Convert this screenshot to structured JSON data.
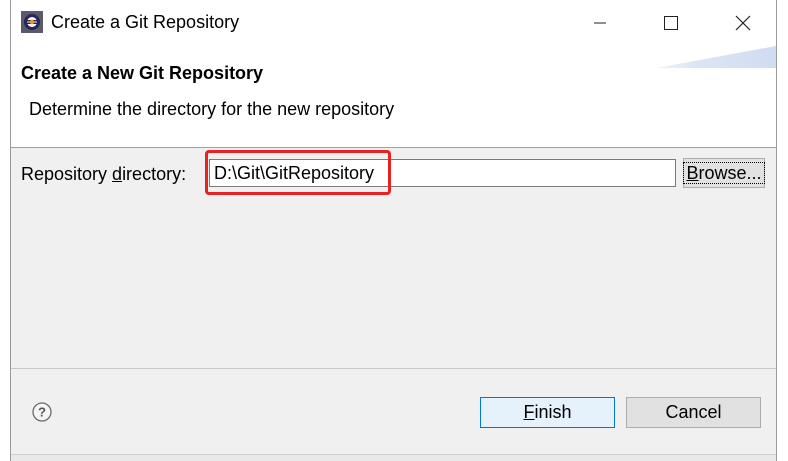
{
  "window": {
    "title": "Create a Git Repository",
    "app_icon": "eclipse-icon"
  },
  "titlebar_controls": [
    "minimize-icon",
    "maximize-icon",
    "close-icon"
  ],
  "banner": {
    "title": "Create a New Git Repository",
    "description": "Determine the directory for the new repository"
  },
  "form": {
    "repo_label_before": "Repository ",
    "repo_label_mnemonic": "d",
    "repo_label_after": "irectory:",
    "repo_value": "D:\\Git\\GitRepository",
    "browse_mnemonic": "B",
    "browse_rest": "rowse..."
  },
  "footer": {
    "help_icon": "help-icon",
    "finish_mnemonic": "F",
    "finish_rest": "inish",
    "cancel_label": "Cancel"
  },
  "colors": {
    "highlight": "#e62222",
    "default_button_border": "#0078d7"
  }
}
